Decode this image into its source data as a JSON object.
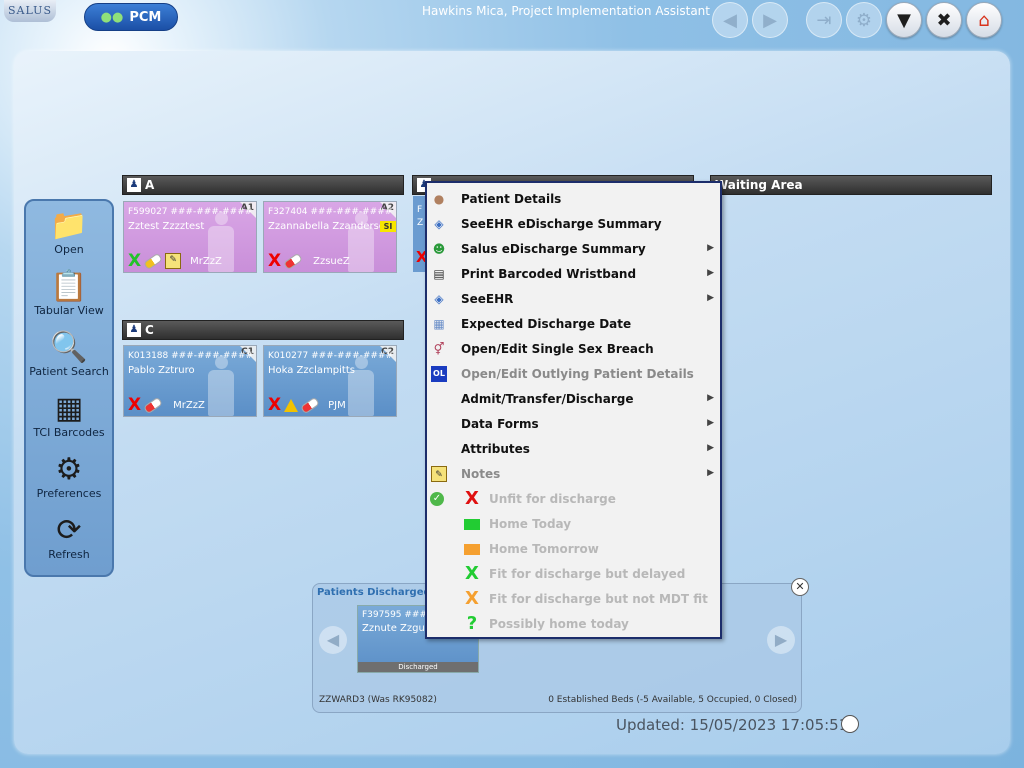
{
  "app": {
    "logo": "SALUS",
    "pcm_label": "PCM",
    "user_title": "Hawkins Mica, Project Implementation Assistant",
    "updated": "Updated: 15/05/2023 17:05:51"
  },
  "sidebar": {
    "items": [
      {
        "label": "Open",
        "icon": "folder-icon"
      },
      {
        "label": "Tabular View",
        "icon": "clipboard-icon"
      },
      {
        "label": "Patient Search",
        "icon": "magnifier-icon"
      },
      {
        "label": "TCI Barcodes",
        "icon": "qr-code-icon"
      },
      {
        "label": "Preferences",
        "icon": "gear-icon"
      },
      {
        "label": "Refresh",
        "icon": "refresh-icon"
      }
    ]
  },
  "bays": {
    "a": {
      "name": "A"
    },
    "c": {
      "name": "C"
    },
    "waiting": {
      "name": "Waiting Area"
    },
    "b_partial": {
      "line1": "F",
      "line2": "Z"
    }
  },
  "beds": [
    {
      "bed": "A1",
      "id": "F599027 ###-###-####",
      "name": "Zztest Zzzztest",
      "user": "MrZzZ",
      "sex": "female"
    },
    {
      "bed": "A2",
      "id": "F327404 ###-###-####",
      "name": "Zzannabella Zzanderson",
      "user": "ZzsueZ",
      "sex": "female",
      "flag": "SI"
    },
    {
      "bed": "C1",
      "id": "K013188 ###-###-####",
      "name": "Pablo Zztruro",
      "user": "MrZzZ",
      "sex": "male"
    },
    {
      "bed": "C2",
      "id": "K010277 ###-###-####",
      "name": "Hoka Zzclampitts",
      "user": "PJM",
      "sex": "male"
    }
  ],
  "discharged": {
    "title": "Patients Discharged (4",
    "card_id": "F397595 ###-#",
    "card_name": "Zznute Zzgunray",
    "card_label": "Discharged",
    "ward": "ZZWARD3 (Was RK95082)",
    "beds_summary": "0 Established Beds (-5 Available, 5 Occupied, 0 Closed)"
  },
  "context_menu": {
    "items": [
      {
        "label": "Patient Details",
        "submenu": false,
        "disabled": false,
        "icon": "person-icon"
      },
      {
        "label": "SeeEHR eDischarge Summary",
        "submenu": false,
        "disabled": false,
        "icon": "seeehr-icon"
      },
      {
        "label": "Salus eDischarge Summary",
        "submenu": true,
        "disabled": false,
        "icon": "salus-person-icon"
      },
      {
        "label": "Print Barcoded Wristband",
        "submenu": true,
        "disabled": false,
        "icon": "barcode-icon"
      },
      {
        "label": "SeeEHR",
        "submenu": true,
        "disabled": false,
        "icon": "seeehr-icon"
      },
      {
        "label": "Expected Discharge Date",
        "submenu": false,
        "disabled": false,
        "icon": "calendar-icon"
      },
      {
        "label": "Open/Edit Single Sex Breach",
        "submenu": false,
        "disabled": false,
        "icon": "gender-icon"
      },
      {
        "label": "Open/Edit Outlying Patient Details",
        "submenu": false,
        "disabled": true,
        "icon": "outlier-icon",
        "icon_text": "OL"
      },
      {
        "label": "Admit/Transfer/Discharge",
        "submenu": true,
        "disabled": false,
        "icon": ""
      },
      {
        "label": "Data Forms",
        "submenu": true,
        "disabled": false,
        "icon": ""
      },
      {
        "label": "Attributes",
        "submenu": true,
        "disabled": false,
        "icon": ""
      },
      {
        "label": "Notes",
        "submenu": true,
        "disabled": true,
        "icon": "notepad-icon"
      }
    ],
    "discharge_status": [
      {
        "label": "Unfit for discharge",
        "symbol": "X",
        "color": "#e01010"
      },
      {
        "label": "Home Today",
        "symbol": "",
        "color": "#22cc33"
      },
      {
        "label": "Home Tomorrow",
        "symbol": "",
        "color": "#f5a030"
      },
      {
        "label": "Fit for discharge but delayed",
        "symbol": "X",
        "color": "#22cc33"
      },
      {
        "label": "Fit for discharge but not MDT fit",
        "symbol": "X",
        "color": "#f5a030"
      },
      {
        "label": "Possibly home today",
        "symbol": "?",
        "color": "#22cc33"
      }
    ]
  },
  "colors": {
    "menu_border": "#1c2d6b",
    "female_bed": "#d9a6e6",
    "male_bed": "#6a9bd0"
  }
}
